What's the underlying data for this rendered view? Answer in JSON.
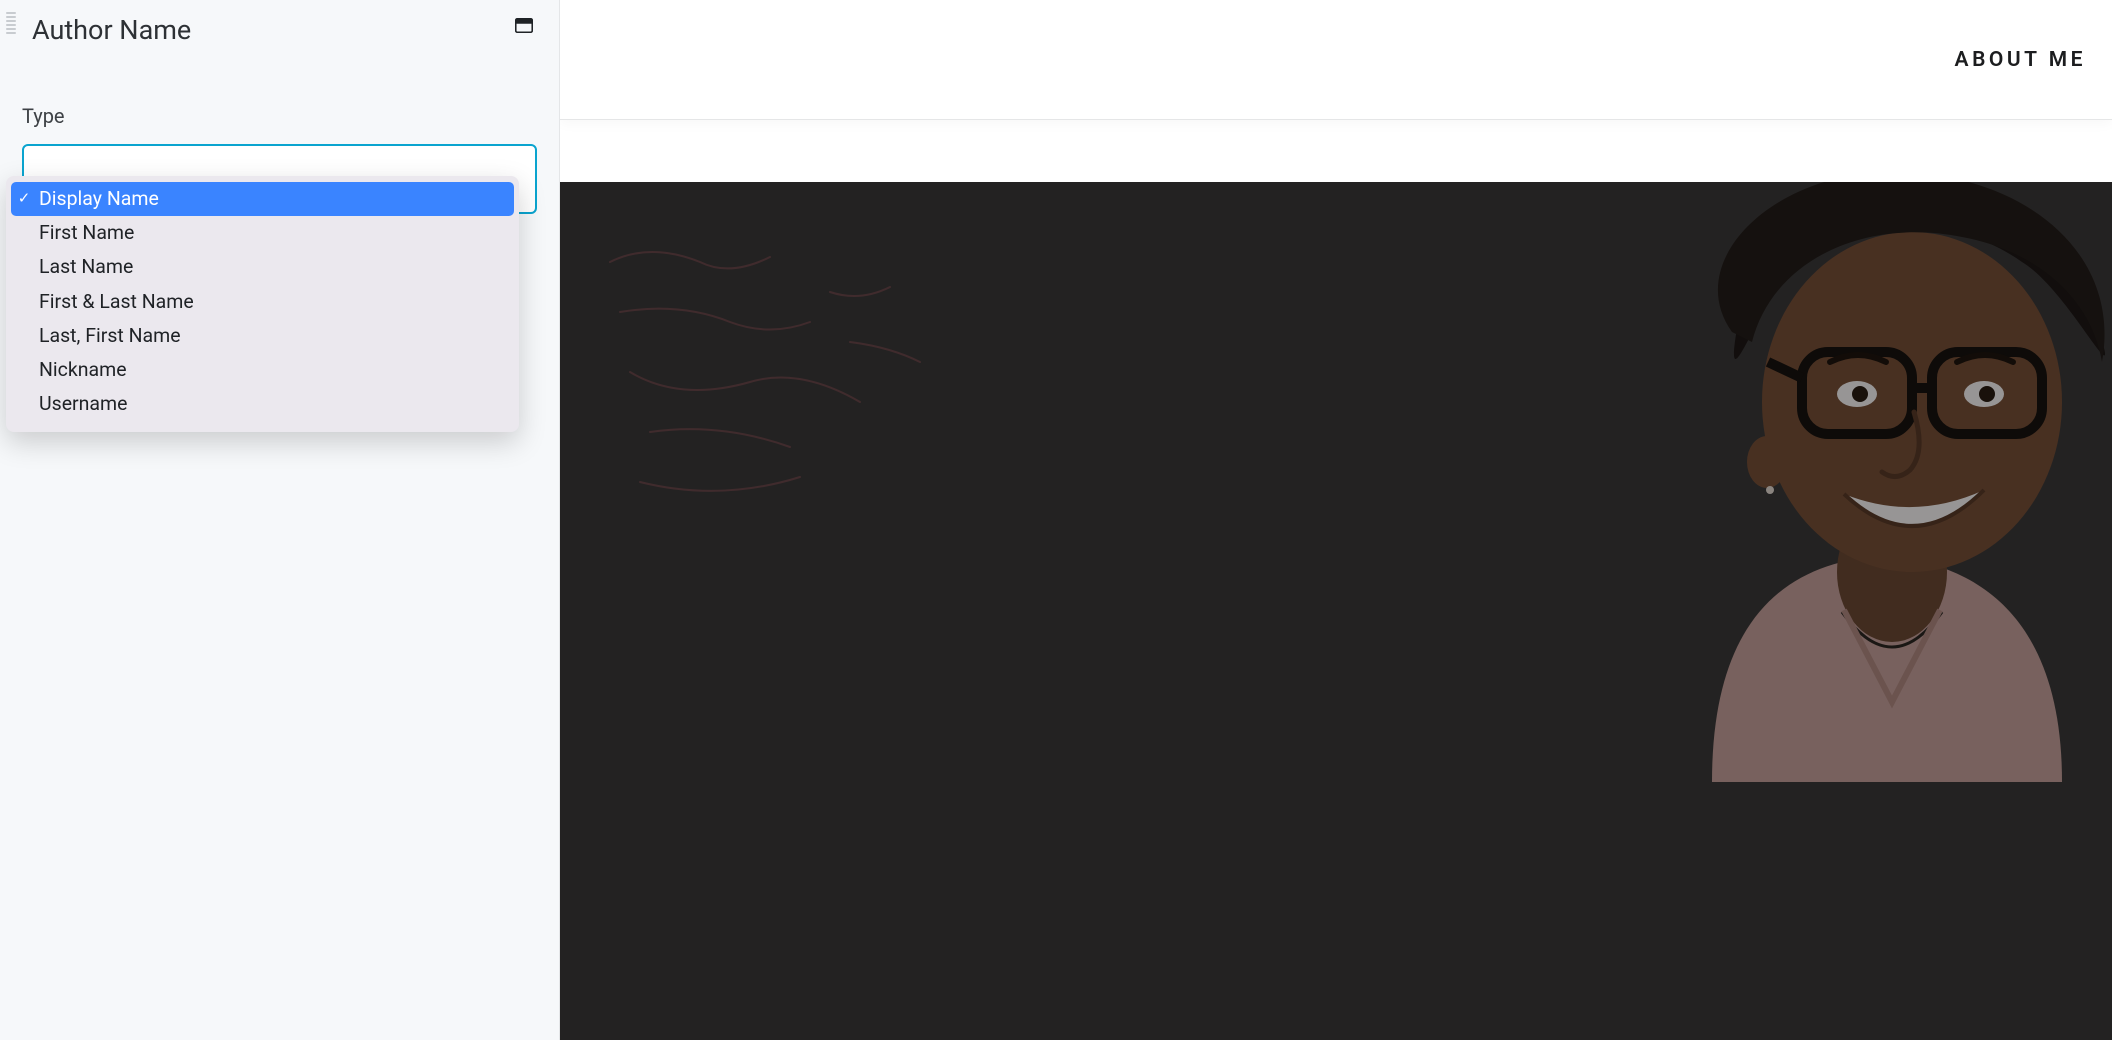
{
  "panel": {
    "title": "Author Name",
    "type_label": "Type"
  },
  "dropdown": {
    "selected_index": 0,
    "options": [
      "Display Name",
      "First Name",
      "Last Name",
      "First & Last Name",
      "Last, First Name",
      "Nickname",
      "Username"
    ]
  },
  "preview": {
    "nav_link": "ABOUT ME"
  }
}
